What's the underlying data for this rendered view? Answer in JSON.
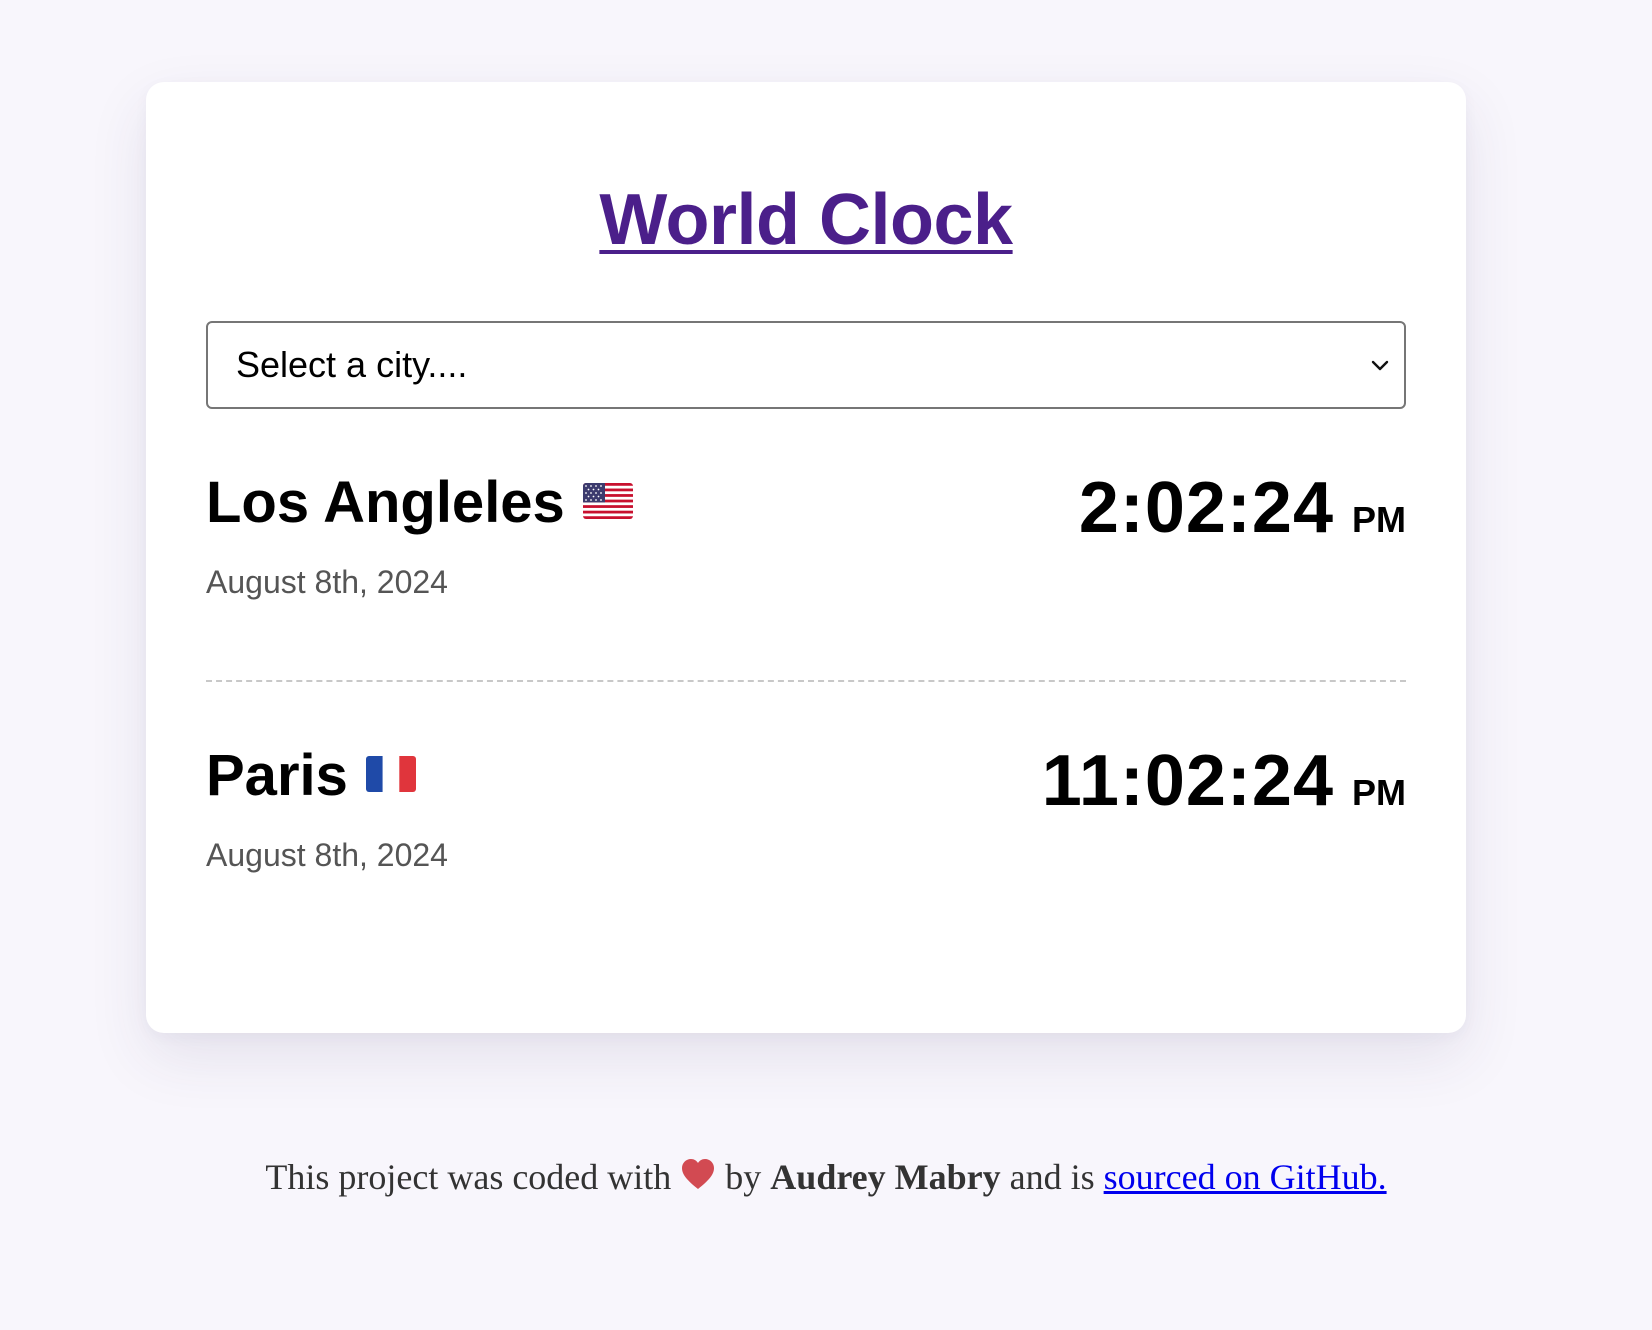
{
  "header": {
    "title": "World Clock"
  },
  "city_select": {
    "placeholder": "Select a city...."
  },
  "cities": [
    {
      "name": "Los Angleles",
      "flag": "us-flag-icon",
      "date": "August 8th, 2024",
      "time": "2:02:24",
      "ampm": "PM"
    },
    {
      "name": "Paris",
      "flag": "fr-flag-icon",
      "date": "August 8th, 2024",
      "time": "11:02:24",
      "ampm": "PM"
    }
  ],
  "footer": {
    "prefix": "This project was coded with",
    "by": "by",
    "author": "Audrey Mabry",
    "middle": "and is",
    "link_text": "sourced on GitHub.",
    "heart_icon": "heart-icon"
  },
  "colors": {
    "page_background": "#f8f6fc",
    "title": "#4b1f8a",
    "link": "#0000ee",
    "date_text": "#555555"
  }
}
